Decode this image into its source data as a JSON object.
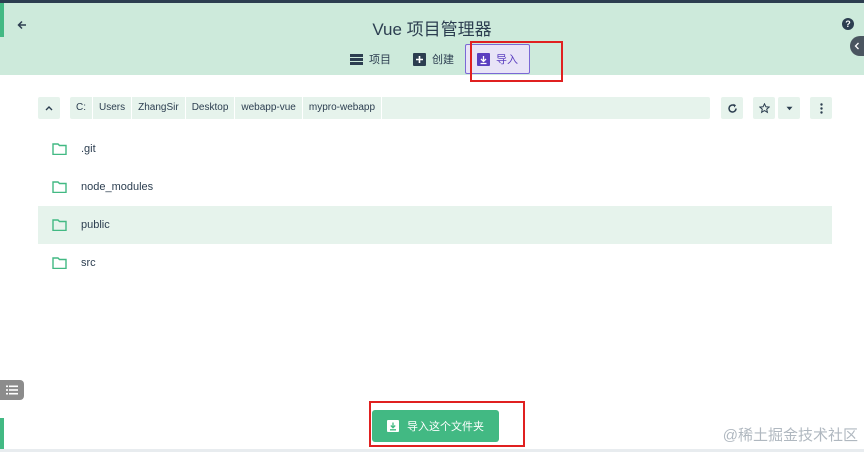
{
  "header": {
    "title": "Vue 项目管理器",
    "tabs": [
      {
        "label": "项目",
        "icon": "list-icon"
      },
      {
        "label": "创建",
        "icon": "plus-icon"
      },
      {
        "label": "导入",
        "icon": "import-icon",
        "active": true
      }
    ]
  },
  "pathbar": {
    "crumbs": [
      "C:",
      "Users",
      "ZhangSir",
      "Desktop",
      "webapp-vue",
      "mypro-webapp"
    ]
  },
  "files": [
    {
      "name": ".git"
    },
    {
      "name": "node_modules"
    },
    {
      "name": "public",
      "selected": true
    },
    {
      "name": "src"
    }
  ],
  "actions": {
    "import_folder_label": "导入这个文件夹"
  },
  "watermark": "@稀土掘金技术社区",
  "colors": {
    "header_bg": "#cdeadb",
    "accent": "#42b983",
    "active_tab": "#7b68d6",
    "highlight": "#e02020"
  }
}
